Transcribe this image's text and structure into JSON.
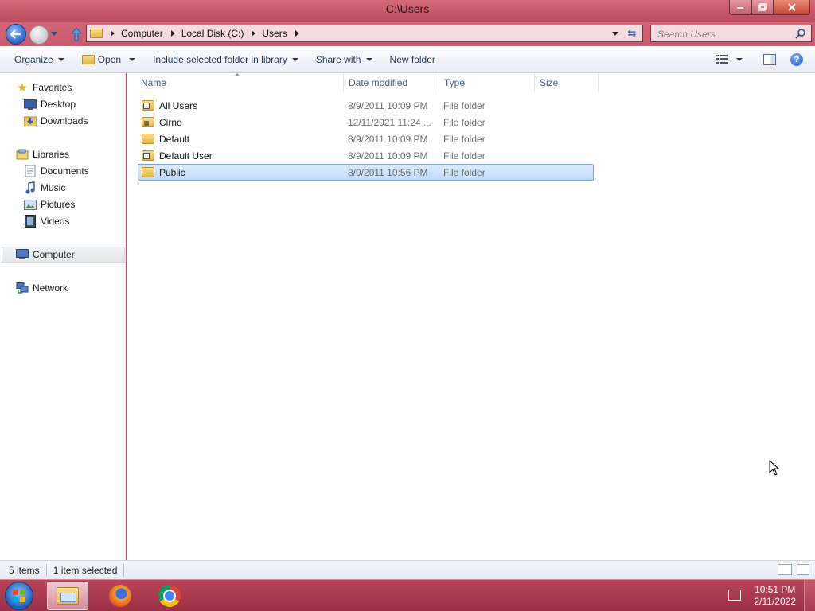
{
  "window": {
    "title": "C:\\Users"
  },
  "address": {
    "crumbs": [
      "Computer",
      "Local Disk (C:)",
      "Users"
    ]
  },
  "search": {
    "placeholder": "Search Users"
  },
  "toolbar": {
    "organize": "Organize",
    "open": "Open",
    "include": "Include selected folder in library",
    "share": "Share with",
    "new_folder": "New folder"
  },
  "navpane": {
    "favorites": "Favorites",
    "desktop": "Desktop",
    "downloads": "Downloads",
    "libraries": "Libraries",
    "documents": "Documents",
    "music": "Music",
    "pictures": "Pictures",
    "videos": "Videos",
    "computer": "Computer",
    "network": "Network"
  },
  "columns": {
    "name": "Name",
    "date": "Date modified",
    "type": "Type",
    "size": "Size"
  },
  "files": [
    {
      "name": "All Users",
      "date": "8/9/2011 10:09 PM",
      "type": "File folder",
      "icon": "folder-shortcut-icon"
    },
    {
      "name": "Cirno",
      "date": "12/11/2021 11:24 ...",
      "type": "File folder",
      "icon": "folder-locked-icon"
    },
    {
      "name": "Default",
      "date": "8/9/2011 10:09 PM",
      "type": "File folder",
      "icon": "folder-icon"
    },
    {
      "name": "Default User",
      "date": "8/9/2011 10:09 PM",
      "type": "File folder",
      "icon": "folder-shortcut-icon"
    },
    {
      "name": "Public",
      "date": "8/9/2011 10:56 PM",
      "type": "File folder",
      "icon": "folder-icon",
      "selected": true
    }
  ],
  "status": {
    "count": "5 items",
    "selection": "1 item selected"
  },
  "taskbar": {
    "time": "10:51 PM",
    "date": "2/11/2022"
  },
  "colors": {
    "frame": "#c84a5a",
    "selection": "#c1dbfc",
    "taskbar": "#9c2f45"
  }
}
